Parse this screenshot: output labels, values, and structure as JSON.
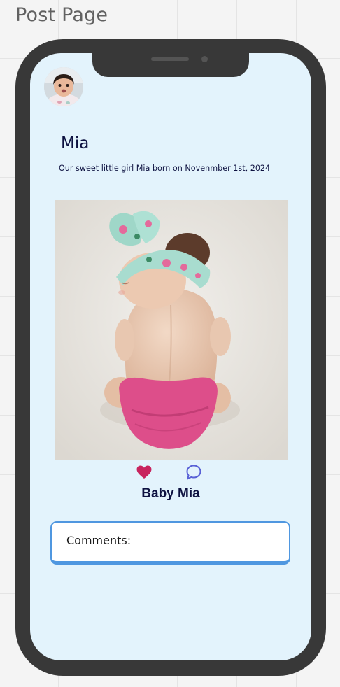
{
  "frame": {
    "title": "Post Page"
  },
  "post": {
    "author": "Mia",
    "caption": "Our sweet little girl Mia born on Novenmber 1st, 2024",
    "photo_title": "Baby Mia"
  },
  "actions": {
    "like_icon": "heart-icon",
    "comment_icon": "speech-bubble-icon"
  },
  "comments": {
    "label": "Comments:"
  },
  "colors": {
    "screen_background": "#e3f3fc",
    "phone_body": "#383838",
    "heart": "#c8245e",
    "comment_icon": "#5961d6",
    "comments_border": "#4f97e0",
    "text_dark": "#0d1140"
  }
}
